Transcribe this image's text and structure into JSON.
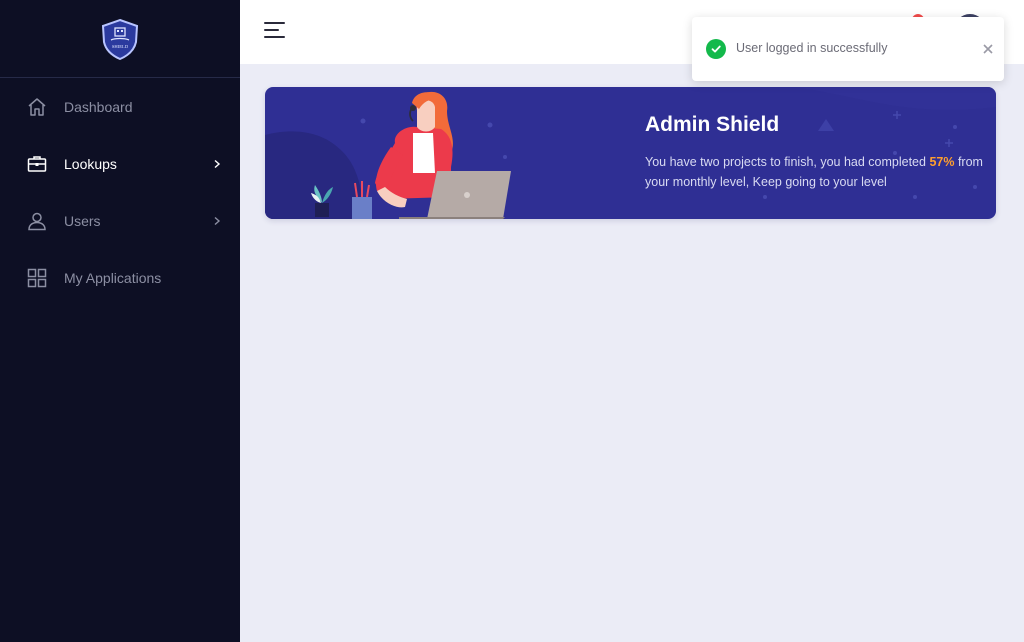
{
  "brand": {
    "logo_text": "SHIELD",
    "logo_icon": "shield-logo"
  },
  "sidebar": {
    "items": [
      {
        "label": "Dashboard",
        "icon": "home-icon",
        "active": false,
        "has_submenu": false
      },
      {
        "label": "Lookups",
        "icon": "briefcase-icon",
        "active": true,
        "has_submenu": true
      },
      {
        "label": "Users",
        "icon": "user-icon",
        "active": false,
        "has_submenu": true
      },
      {
        "label": "My Applications",
        "icon": "grid-icon",
        "active": false,
        "has_submenu": false
      }
    ]
  },
  "topbar": {
    "menu_icon": "hamburger-icon"
  },
  "banner": {
    "title": "Admin Shield",
    "text_before": "You have two projects to finish, you had completed ",
    "percent": "57%",
    "text_after": " from your monthly level, Keep going to your level"
  },
  "toast": {
    "message": "User logged in successfully",
    "icon": "check-circle-icon"
  },
  "colors": {
    "sidebar_bg": "#0d0f24",
    "banner_bg": "#2f2f94",
    "accent_orange": "#ff9f2e",
    "success_green": "#13b94b",
    "page_bg": "#ebecf6"
  }
}
